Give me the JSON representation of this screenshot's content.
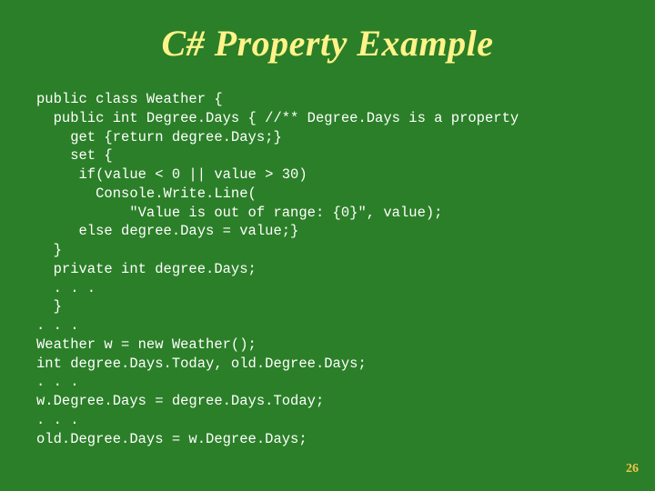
{
  "title": "C# Property Example",
  "code": "public class Weather {\n  public int Degree.Days { //** Degree.Days is a property\n    get {return degree.Days;}\n    set {\n     if(value < 0 || value > 30)\n       Console.Write.Line(\n           \"Value is out of range: {0}\", value);\n     else degree.Days = value;}\n  }\n  private int degree.Days;\n  . . .\n  }\n. . .\nWeather w = new Weather();\nint degree.Days.Today, old.Degree.Days;\n. . .\nw.Degree.Days = degree.Days.Today;\n. . .\nold.Degree.Days = w.Degree.Days;",
  "page_number": "26"
}
